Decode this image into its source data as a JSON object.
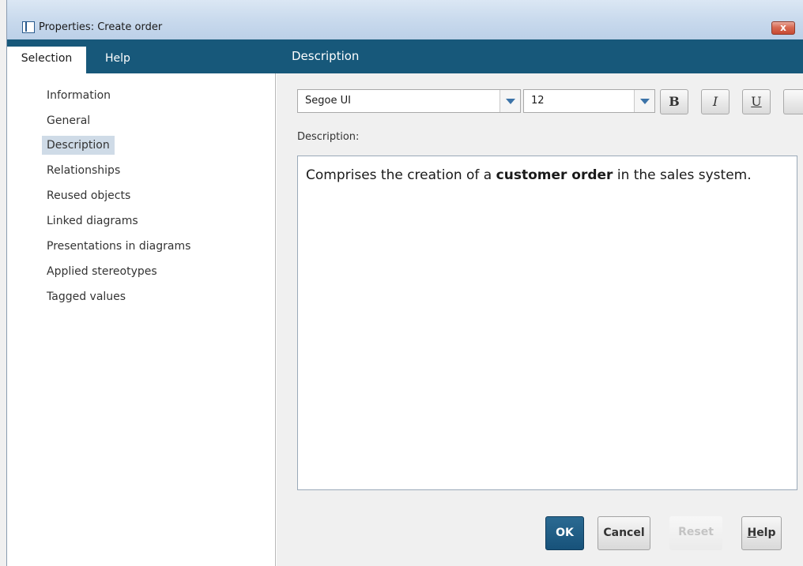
{
  "window": {
    "title": "Properties: Create order",
    "close_glyph": "x"
  },
  "tabs": [
    {
      "label": "Selection",
      "selected": true
    },
    {
      "label": "Help",
      "selected": false
    }
  ],
  "section_title": "Description",
  "nav": {
    "items": [
      {
        "label": "Information"
      },
      {
        "label": "General"
      },
      {
        "label": "Description",
        "selected": true
      },
      {
        "label": "Relationships"
      },
      {
        "label": "Reused objects"
      },
      {
        "label": "Linked diagrams"
      },
      {
        "label": "Presentations in diagrams"
      },
      {
        "label": "Applied stereotypes"
      },
      {
        "label": "Tagged values"
      }
    ]
  },
  "toolbar": {
    "font_family": "Segoe UI",
    "font_size": "12",
    "bold_label": "B",
    "italic_label": "I",
    "underline_label": "U"
  },
  "description": {
    "label": "Description:",
    "text_before": "Comprises the creation of a ",
    "text_bold": "customer order",
    "text_after": " in the sales system."
  },
  "buttons": {
    "ok": "OK",
    "cancel": "Cancel",
    "reset": "Reset",
    "help_mnemonic": "H",
    "help_rest": "elp"
  },
  "colors": {
    "header_bar": "#17587a",
    "selected_nav": "#cfdbe7",
    "close_button": "#d86a52"
  }
}
